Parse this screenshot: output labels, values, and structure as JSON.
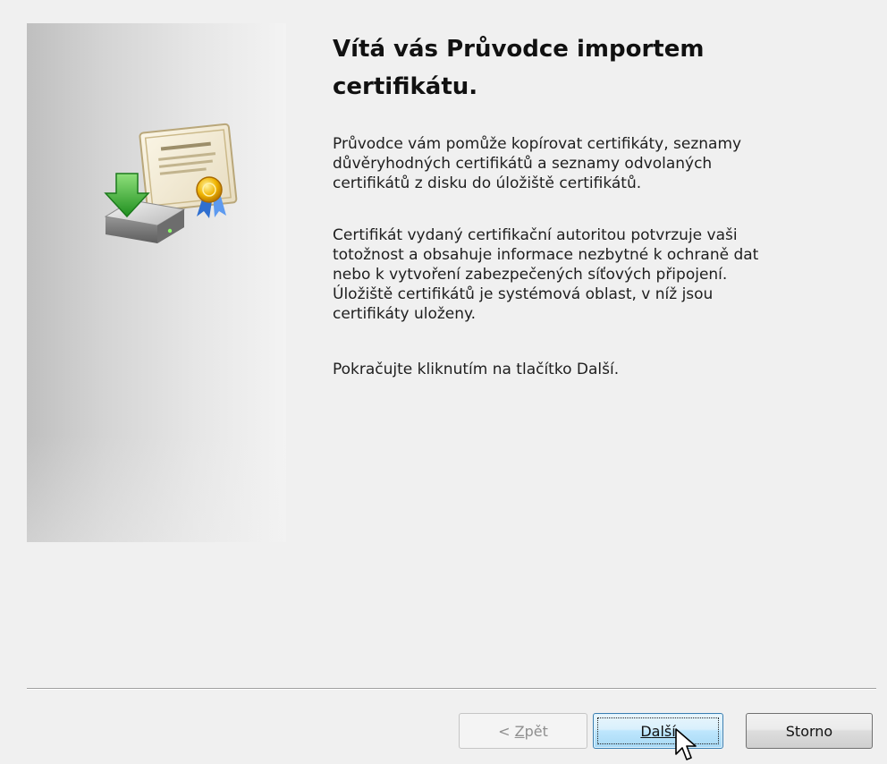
{
  "wizard": {
    "title": "Vítá vás Průvodce importem certifikátu.",
    "paragraphs": {
      "intro": "Průvodce vám pomůže kopírovat certifikáty, seznamy\ndůvěryhodných certifikátů a seznamy odvolaných\ncertifikátů z disku do úložiště certifikátů.",
      "details": "Certifikát vydaný certifikační autoritou potvrzuje vaši\ntotožnost a obsahuje informace nezbytné k ochraně dat\nnebo k vytvoření zabezpečených síťových připojení.\nÚložiště certifikátů je systémová oblast, v níž jsou\ncertifikáty uloženy.",
      "instruction": "Pokračujte kliknutím na tlačítko Další."
    },
    "graphic_icon": "certificate-import-icon"
  },
  "buttons": {
    "back": {
      "prefix": "< ",
      "accel": "Z",
      "rest": "pět",
      "enabled": false
    },
    "next": {
      "accel": "D",
      "rest": "alší",
      "focused": true
    },
    "cancel": {
      "label": "Storno"
    }
  },
  "colors": {
    "dialog_bg": "#f0f0f0",
    "focus_border": "#3c7fb1",
    "disabled_text": "#8f8f8f"
  },
  "cursor_icon": "arrow-cursor-icon"
}
